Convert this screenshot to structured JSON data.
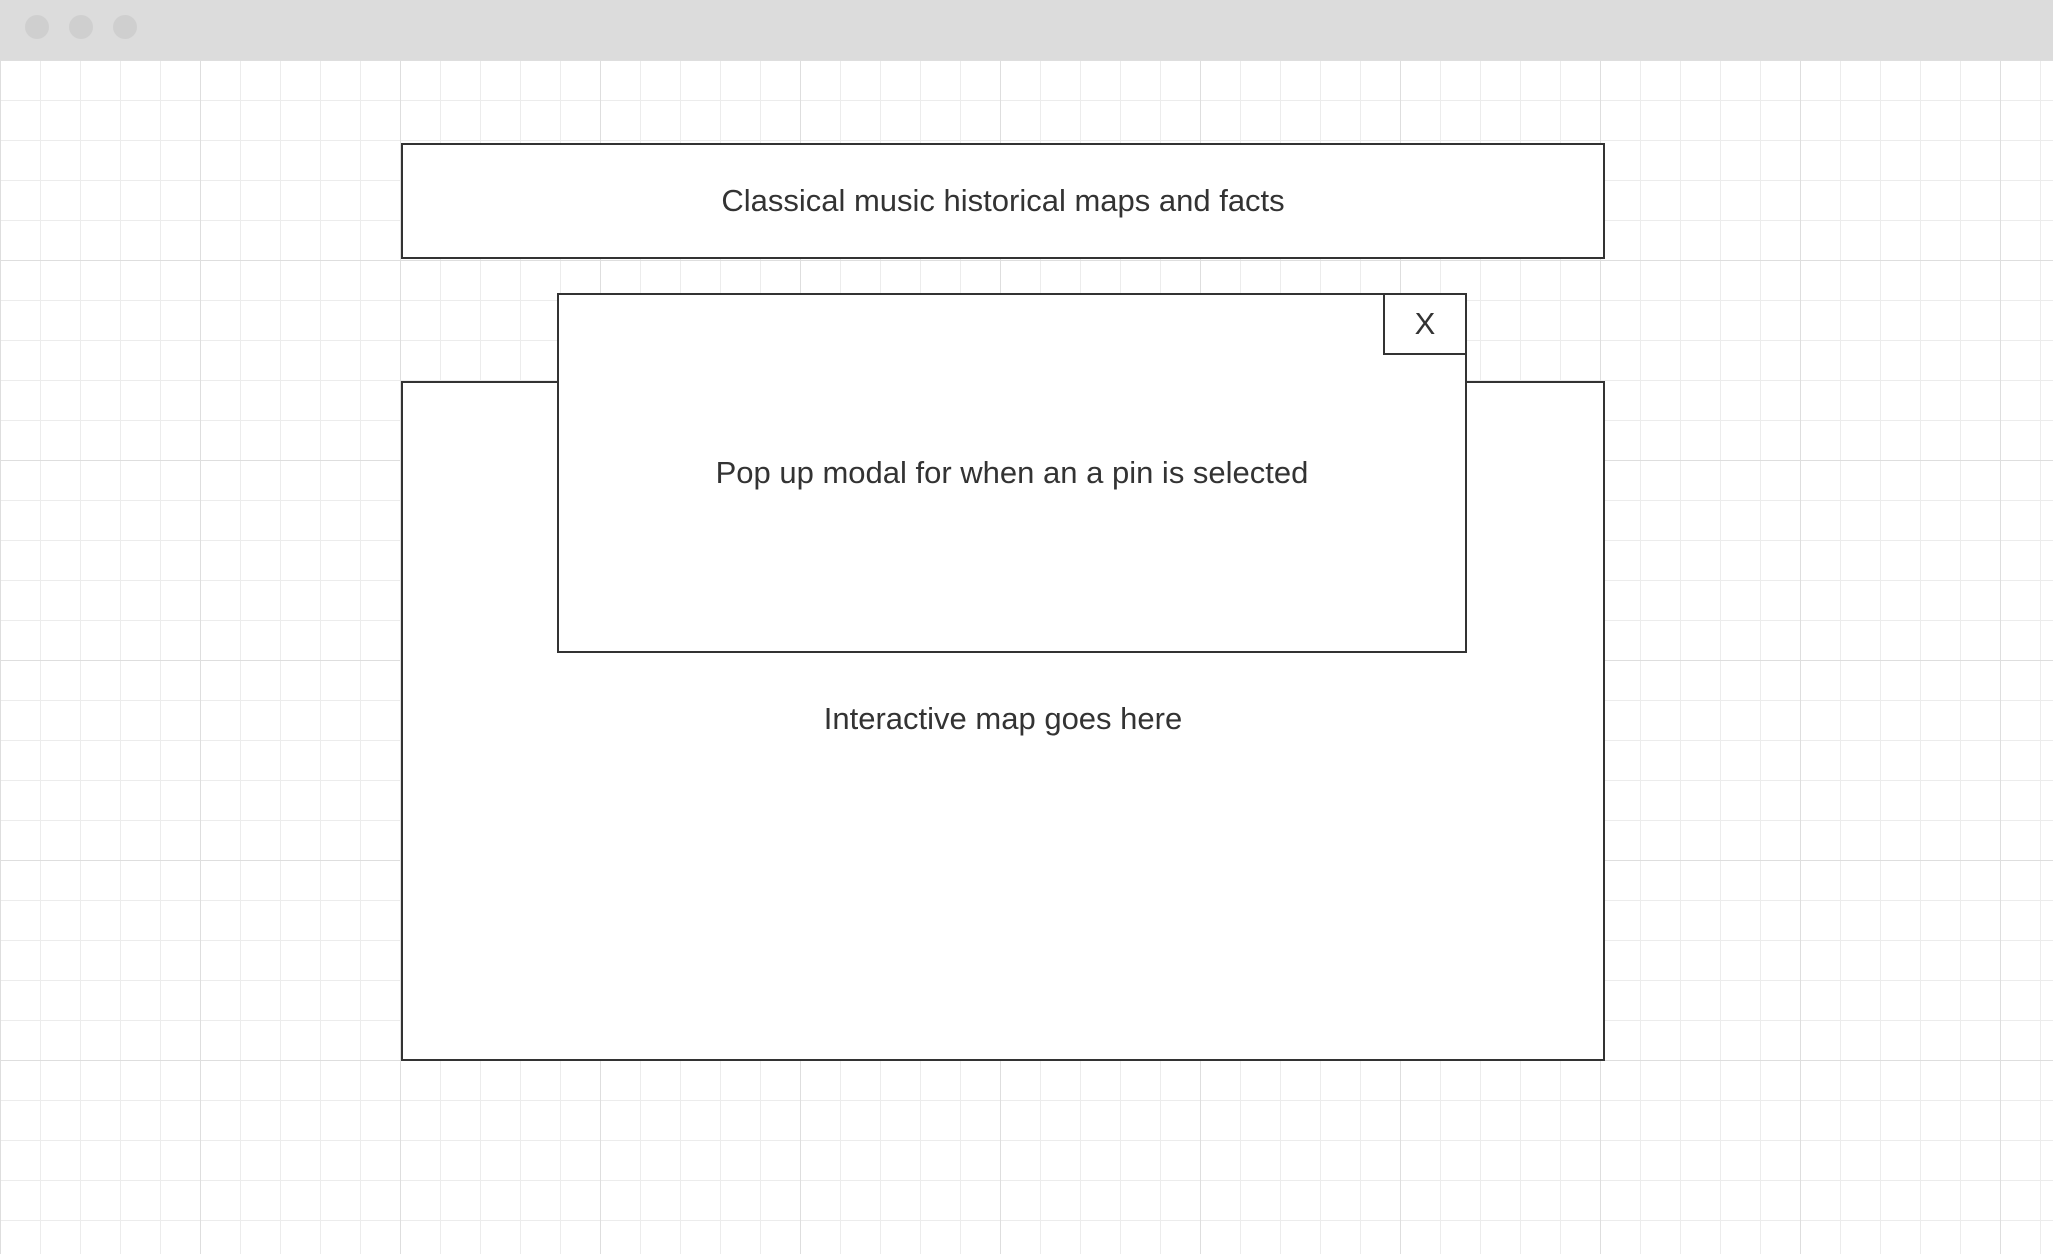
{
  "window": {
    "controls": [
      "window-dot",
      "window-dot",
      "window-dot"
    ],
    "chrome_color": "#dcdcdc",
    "dot_color": "#cfcfcf"
  },
  "header": {
    "title": "Classical music historical maps and facts"
  },
  "map": {
    "placeholder": "Interactive map goes here"
  },
  "modal": {
    "text": "Pop up modal for when an a pin is selected",
    "close_label": "X"
  },
  "colors": {
    "border": "#333333",
    "text": "#333333",
    "grid_major": "#dedede",
    "grid_minor": "#ececec"
  }
}
